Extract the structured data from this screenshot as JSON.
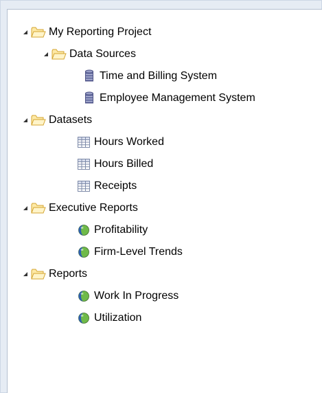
{
  "tree": {
    "root": {
      "label": "My Reporting Project",
      "icon": "folder-icon"
    },
    "data_sources": {
      "label": "Data Sources",
      "icon": "folder-icon",
      "items": [
        {
          "label": "Time and Billing System",
          "icon": "database-icon"
        },
        {
          "label": "Employee Management System",
          "icon": "database-icon"
        }
      ]
    },
    "datasets": {
      "label": "Datasets",
      "icon": "folder-icon",
      "items": [
        {
          "label": "Hours Worked",
          "icon": "table-grid-icon"
        },
        {
          "label": "Hours Billed",
          "icon": "table-grid-icon"
        },
        {
          "label": "Receipts",
          "icon": "table-grid-icon"
        }
      ]
    },
    "executive_reports": {
      "label": "Executive Reports",
      "icon": "folder-icon",
      "items": [
        {
          "label": "Profitability",
          "icon": "report-sphere-icon"
        },
        {
          "label": "Firm-Level Trends",
          "icon": "report-sphere-icon"
        }
      ]
    },
    "reports": {
      "label": "Reports",
      "icon": "folder-icon",
      "items": [
        {
          "label": "Work In Progress",
          "icon": "report-sphere-icon"
        },
        {
          "label": "Utilization",
          "icon": "report-sphere-icon"
        }
      ]
    }
  },
  "colors": {
    "folder_fill": "#fde9a6",
    "folder_stroke": "#d4a531",
    "database_fill": "#6e75a6",
    "grid_stroke": "#7d8aa8",
    "sphere_blue": "#2e5fb0",
    "sphere_green": "#6fba49"
  }
}
